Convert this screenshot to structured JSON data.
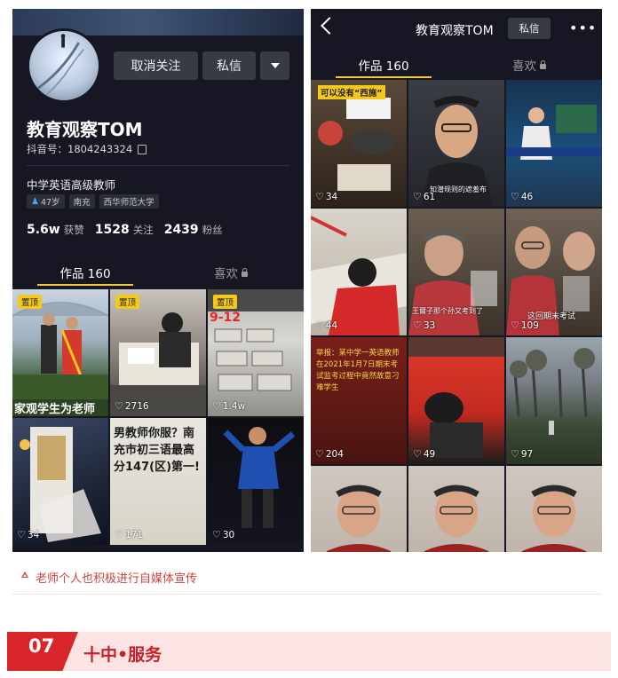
{
  "left_profile": {
    "unfollow_label": "取消关注",
    "message_label": "私信",
    "name": "教育观察TOM",
    "douyin_id": "抖音号：1804243324",
    "bio": "中学英语高级教师",
    "tags": [
      "47岁",
      "南充",
      "西华师范大学"
    ],
    "stats": [
      {
        "value": "5.6w",
        "label": "获赞"
      },
      {
        "value": "1528",
        "label": "关注"
      },
      {
        "value": "2439",
        "label": "粉丝"
      }
    ],
    "tabs": [
      {
        "label": "作品 160"
      },
      {
        "label": "喜欢"
      }
    ],
    "videos": [
      {
        "pinned": "置顶",
        "likes": "",
        "overlay": "家观学生为老师"
      },
      {
        "pinned": "置顶",
        "likes": "2716",
        "overlay": ""
      },
      {
        "pinned": "置顶",
        "likes": "1.4w",
        "overlay": "9-12"
      },
      {
        "pinned": "",
        "likes": "34",
        "overlay": ""
      },
      {
        "pinned": "",
        "likes": "171",
        "overlay": "男教师你服？南充市初三语最高分147(区)第一!"
      },
      {
        "pinned": "",
        "likes": "30",
        "overlay": ""
      }
    ]
  },
  "right_profile": {
    "title": "教育观察TOM",
    "message_label": "私信",
    "tabs": [
      {
        "label": "作品 160"
      },
      {
        "label": "喜欢"
      }
    ],
    "videos": [
      {
        "likes": "34",
        "overlay": "可以没有“西施”",
        "caption": ""
      },
      {
        "likes": "61",
        "overlay": "",
        "caption": "知潜规则的遮羞布"
      },
      {
        "likes": "46",
        "overlay": "",
        "caption": ""
      },
      {
        "likes": "44",
        "overlay": "",
        "caption": ""
      },
      {
        "likes": "33",
        "overlay": "",
        "caption": "王爾子那个孙又考到了"
      },
      {
        "likes": "109",
        "overlay": "",
        "caption": "这回期末考试"
      },
      {
        "likes": "204",
        "overlay": "举报：某中学一英语教师在2021年1月7日期末考试监考过程中竟然故意刁难学生",
        "caption": ""
      },
      {
        "likes": "49",
        "overlay": "",
        "caption": ""
      },
      {
        "likes": "97",
        "overlay": "",
        "caption": ""
      },
      {
        "likes": "",
        "overlay": "",
        "caption": ""
      },
      {
        "likes": "",
        "overlay": "",
        "caption": ""
      },
      {
        "likes": "",
        "overlay": "",
        "caption": ""
      }
    ]
  },
  "caption": "老师个人也积极进行自媒体宣传",
  "section": {
    "number": "07",
    "title": "十中•服务"
  },
  "colors": {
    "accent_red": "#d8262b",
    "pin_yellow": "#f5c81d",
    "app_bg": "#161722"
  }
}
